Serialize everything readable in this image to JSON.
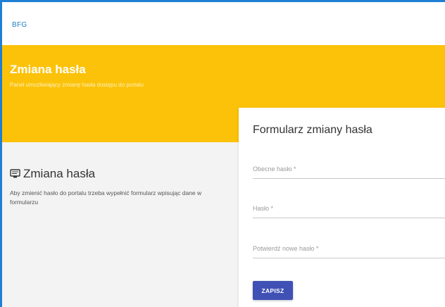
{
  "header": {
    "brand": "BFG"
  },
  "banner": {
    "title": "Zmiana hasła",
    "subtitle": "Panel umożliwiający zmianę hasła dostępu do portalu"
  },
  "info": {
    "icon": "monitor-icon",
    "title": "Zmiana hasła",
    "description": "Aby zmienić hasło do portalu trzeba wypełnić formularz wpisując dane w formularzu"
  },
  "form": {
    "title": "Formularz zmiany hasła",
    "current_password": {
      "placeholder": "Obecne hasło *",
      "value": ""
    },
    "new_password": {
      "placeholder": "Hasło *",
      "value": ""
    },
    "confirm_password": {
      "placeholder": "Potwierdź nowe hasło *",
      "value": ""
    },
    "save_label": "ZAPISZ"
  },
  "colors": {
    "accent_yellow": "#fcc20a",
    "button_blue": "#3f51b5",
    "brand_blue": "#1a7fc4"
  }
}
